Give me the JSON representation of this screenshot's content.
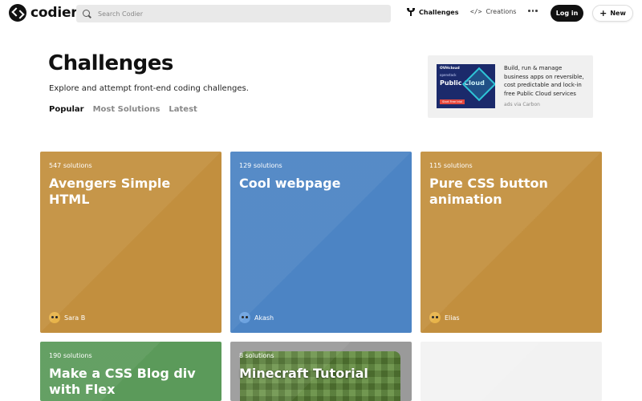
{
  "header": {
    "logo_text": "codier",
    "search_placeholder": "Search Codier",
    "nav": {
      "challenges": "Challenges",
      "creations": "Creations"
    },
    "login_label": "Log in",
    "new_label": "New"
  },
  "hero": {
    "title": "Challenges",
    "subtitle": "Explore and attempt front-end coding challenges.",
    "tabs": [
      "Popular",
      "Most Solutions",
      "Latest"
    ],
    "active_tab": "Popular"
  },
  "ad": {
    "image_brand": "OVHcloud",
    "image_brand2": "openstack",
    "image_headline": "Public Cloud",
    "image_cta": "Start Free trial",
    "text": "Build, run & manage business apps on reversible, cost predictable and lock-in free Public Cloud services",
    "via": "ads via Carbon"
  },
  "cards": [
    {
      "solutions": "547 solutions",
      "title": "Avengers Simple HTML",
      "author": "Sara B",
      "color": "#c28f3e",
      "avatar_color": "#e8b44a"
    },
    {
      "solutions": "129 solutions",
      "title": "Cool webpage",
      "author": "Akash",
      "color": "#4c84c4",
      "avatar_color": "#6da3e0"
    },
    {
      "solutions": "115 solutions",
      "title": "Pure CSS button animation",
      "author": "Elias",
      "color": "#c28f3e",
      "avatar_color": "#e8b44a"
    },
    {
      "solutions": "190 solutions",
      "title": "Make a CSS Blog div with Flex",
      "author": "",
      "color": "#5b9a5a",
      "avatar_color": ""
    },
    {
      "solutions": "8 solutions",
      "title": "Minecraft Tutorial",
      "author": "",
      "color": "#9a9a9a",
      "avatar_color": ""
    }
  ]
}
